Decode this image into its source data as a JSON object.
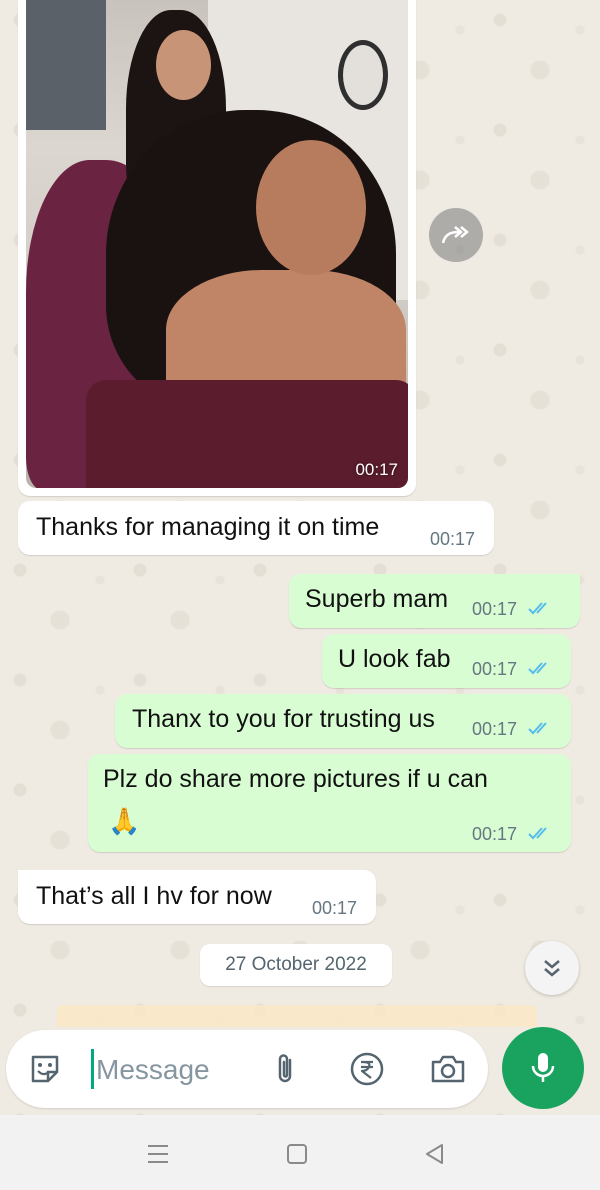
{
  "chat": {
    "image_message": {
      "time": "00:17"
    },
    "messages": [
      {
        "direction": "in",
        "text": "Thanks for managing it on time",
        "time": "00:17"
      },
      {
        "direction": "out",
        "text": "Superb mam",
        "time": "00:17",
        "status": "read"
      },
      {
        "direction": "out",
        "text": "U look fab",
        "time": "00:17",
        "status": "read"
      },
      {
        "direction": "out",
        "text": "Thanx to you for trusting us",
        "time": "00:17",
        "status": "read"
      },
      {
        "direction": "out",
        "text": "Plz do share more pictures if u can",
        "emoji": "🙏",
        "time": "00:17",
        "status": "read"
      },
      {
        "direction": "in",
        "text": "That’s all I hv for now",
        "time": "00:17"
      }
    ],
    "date_separator": "27 October 2022"
  },
  "composer": {
    "placeholder": "Message",
    "icons": [
      "sticker-icon",
      "attach-icon",
      "rupee-payment-icon",
      "camera-icon",
      "mic-icon"
    ]
  },
  "colors": {
    "incoming_bubble": "#ffffff",
    "outgoing_bubble": "#d9fdd3",
    "read_ticks": "#53bdeb",
    "accent_green": "#1aa35f",
    "chat_background": "#efeae2"
  },
  "navbar": {
    "icons": [
      "menu-icon",
      "home-icon",
      "back-icon"
    ]
  }
}
